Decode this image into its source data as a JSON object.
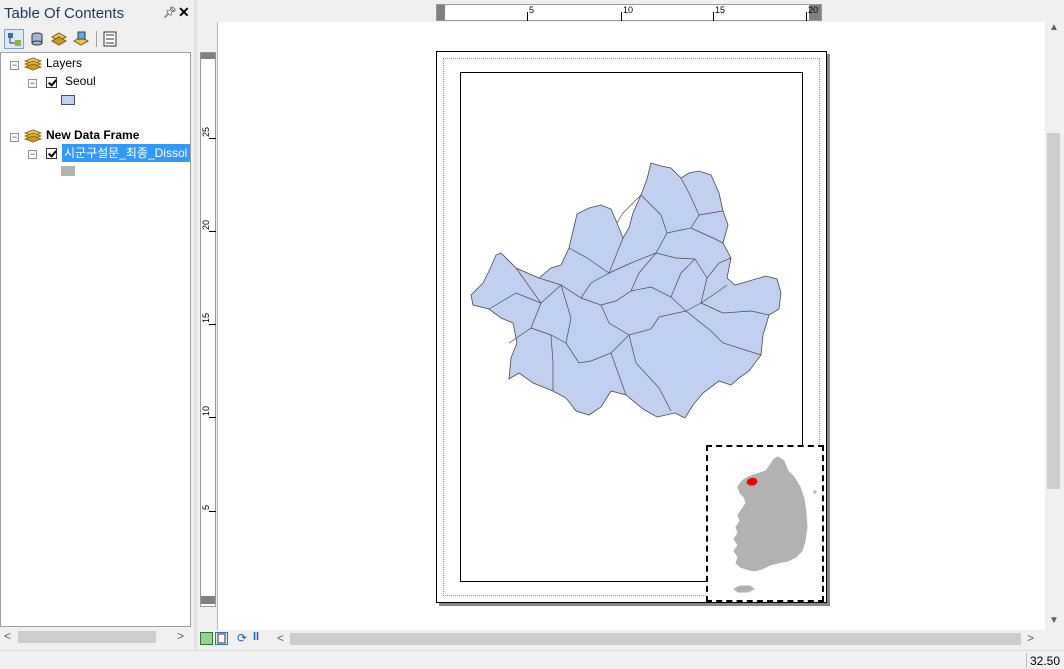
{
  "toc": {
    "title": "Table Of Contents",
    "pin_icon": "pin-icon",
    "close_icon": "close-icon",
    "toolbar": [
      "list-by-drawing-order-icon",
      "list-by-source-icon",
      "list-by-visibility-icon",
      "list-by-selection-icon",
      "options-icon"
    ],
    "frames": [
      {
        "name": "Layers",
        "bold": false,
        "layers": [
          {
            "name": "Seoul",
            "checked": true,
            "swatch_fill": "#c1cff1",
            "swatch_stroke": "#4a4a6a",
            "selected": false
          }
        ]
      },
      {
        "name": "New Data Frame",
        "bold": true,
        "layers": [
          {
            "name": "시군구설문_최종_Dissol",
            "checked": true,
            "swatch_fill": "#b2b2b2",
            "swatch_stroke": "#b2b2b2",
            "selected": true
          }
        ]
      }
    ]
  },
  "ruler": {
    "horizontal": [
      "5",
      "10",
      "15",
      "20"
    ],
    "vertical": [
      "5",
      "10",
      "15",
      "20",
      "25"
    ]
  },
  "map": {
    "fill": "#c1cff1",
    "stroke": "#4a4a4a",
    "inset_fill": "#b2b2b2",
    "highlight": "#e60000"
  },
  "view_controls": [
    "data-view-icon",
    "layout-view-icon",
    "refresh-icon",
    "pause-icon"
  ],
  "status": {
    "coordinates": "32.50"
  }
}
